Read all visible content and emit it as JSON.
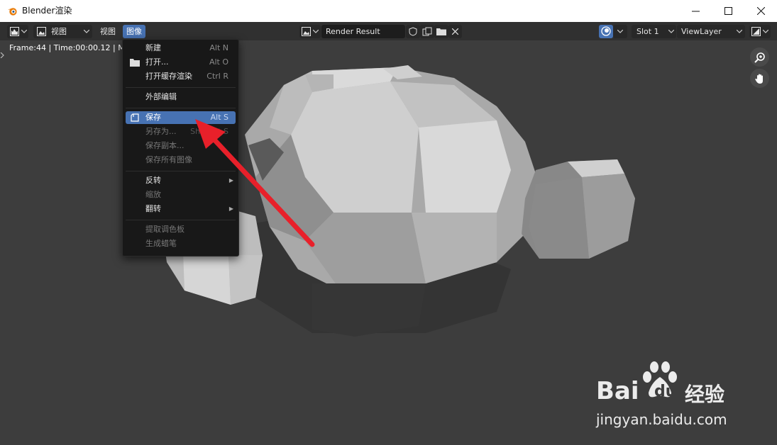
{
  "window": {
    "title": "Blender渲染",
    "logo_icon": "blender-logo-icon",
    "minimize_icon": "minimize-icon",
    "maximize_icon": "maximize-icon",
    "close_icon": "close-icon"
  },
  "header": {
    "editor_type_icon": "image-editor-icon",
    "mode_label": "视图",
    "menus": [
      "视图",
      "图像"
    ],
    "active_menu": "图像",
    "image_name": "Render Result",
    "slot_label": "Slot 1",
    "layer_label": "ViewLayer"
  },
  "viewport": {
    "frame_info": "Frame:44 | Time:00:00.12 | Mem"
  },
  "image_menu": {
    "items": [
      {
        "label": "新建",
        "shortcut": "Alt N"
      },
      {
        "label": "打开...",
        "shortcut": "Alt O",
        "icon": "folder-icon"
      },
      {
        "label": "打开缓存渲染",
        "shortcut": "Ctrl R"
      },
      {
        "label": "外部编辑",
        "shortcut": ""
      },
      {
        "label": "保存",
        "shortcut": "Alt S",
        "icon": "save-icon"
      },
      {
        "label": "另存为...",
        "shortcut": "Shift Alt S"
      },
      {
        "label": "保存副本...",
        "shortcut": ""
      },
      {
        "label": "保存所有图像",
        "shortcut": ""
      },
      {
        "label": "反转",
        "shortcut": ""
      },
      {
        "label": "缩放",
        "shortcut": ""
      },
      {
        "label": "翻转",
        "shortcut": ""
      },
      {
        "label": "提取调色板",
        "shortcut": ""
      },
      {
        "label": "生成蜡笔",
        "shortcut": ""
      }
    ]
  },
  "watermark": {
    "brand": "Bai",
    "brand2": "du",
    "product": "经验",
    "url": "jingyan.baidu.com"
  },
  "colors": {
    "highlight": "#4772b3",
    "arrow": "#e8202a"
  }
}
